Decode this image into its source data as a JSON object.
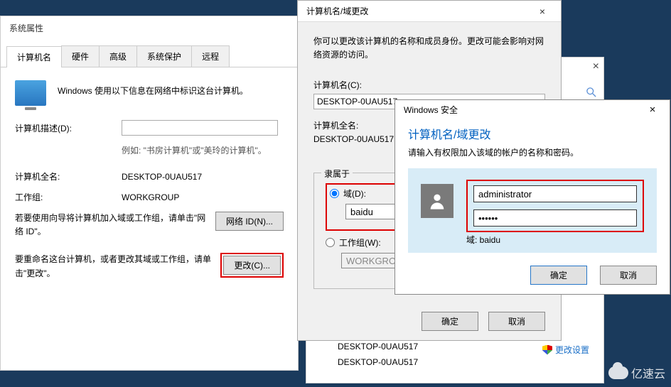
{
  "win1": {
    "title": "系统属性",
    "tabs": [
      "计算机名",
      "硬件",
      "高级",
      "系统保护",
      "远程"
    ],
    "intro": "Windows 使用以下信息在网络中标识这台计算机。",
    "desc_label": "计算机描述(D):",
    "desc_value": "",
    "example": "例如: \"书房计算机\"或\"美玲的计算机\"。",
    "fullname_label": "计算机全名:",
    "fullname_value": "DESKTOP-0UAU517",
    "workgroup_label": "工作组:",
    "workgroup_value": "WORKGROUP",
    "para1": "若要使用向导将计算机加入域或工作组，请单击\"网络 ID\"。",
    "netid_btn": "网络 ID(N)...",
    "para2": "要重命名这台计算机，或者更改其域或工作组，请单击\"更改\"。",
    "change_btn": "更改(C)..."
  },
  "win2": {
    "title": "计算机名/域更改",
    "desc": "你可以更改该计算机的名称和成员身份。更改可能会影响对网络资源的访问。",
    "compname_label": "计算机名(C):",
    "compname_value": "DESKTOP-0UAU517",
    "fullname_label": "计算机全名:",
    "fullname_value": "DESKTOP-0UAU517",
    "group_title": "隶属于",
    "radio_domain": "域(D):",
    "domain_value": "baidu",
    "radio_workgroup": "工作组(W):",
    "workgroup_value": "WORKGROUP",
    "ok": "确定",
    "cancel": "取消"
  },
  "winbg": {
    "link": "更改设置",
    "items": [
      "DESKTOP-0UAU517",
      "DESKTOP-0UAU517"
    ]
  },
  "win3": {
    "title": "Windows 安全",
    "blue_title": "计算机名/域更改",
    "subtext": "请输入有权限加入该域的帐户的名称和密码。",
    "username": "administrator",
    "password": "●●●●●●",
    "domain_label": "域: baidu",
    "ok": "确定",
    "cancel": "取消"
  },
  "watermark": "亿速云"
}
